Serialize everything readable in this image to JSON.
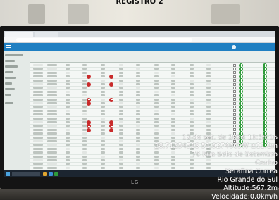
{
  "photo": {
    "caption": "REGISTRO 2",
    "monitor_brand": "LG"
  },
  "screen": {
    "browser_tab_label": "",
    "url": "",
    "user_label": "",
    "taskbar_search": "",
    "accent_color": "#1f7fc2",
    "status_colors": {
      "alert": "#c92b2b",
      "ok": "#2f9b3a"
    },
    "table_rows": 28
  },
  "geotag": {
    "datetime": "12 de set. de 2024 10:38:16",
    "coordinates": "28.7125451S 51.9274669W ±11.1m",
    "street": "76 Rua Sete de Setembro",
    "district": "Centro",
    "city": "Serafina Correa",
    "state": "Rio Grande do Sul",
    "altitude": "Altitude:567.2m",
    "speed": "Velocidade:0.0km/h"
  }
}
